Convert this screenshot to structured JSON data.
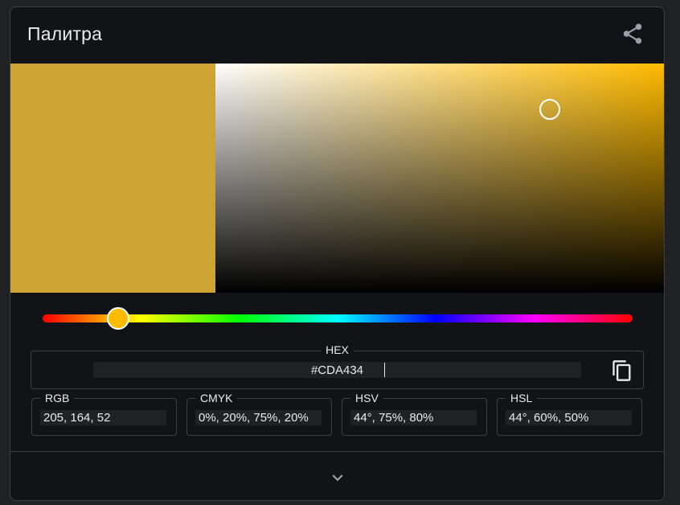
{
  "card": {
    "title": "Палитра",
    "share_icon": "share-icon"
  },
  "color": {
    "swatch_hex": "#CDA434",
    "hue_color": "#ffbb00",
    "hue_degrees": 44,
    "saturation_percent": 75,
    "value_percent": 80
  },
  "fields": {
    "hex": {
      "label": "HEX",
      "value": "#CDA434"
    },
    "rgb": {
      "label": "RGB",
      "value": "205, 164, 52"
    },
    "cmyk": {
      "label": "CMYK",
      "value": "0%, 20%, 75%, 20%"
    },
    "hsv": {
      "label": "HSV",
      "value": "44°, 75%, 80%"
    },
    "hsl": {
      "label": "HSL",
      "value": "44°, 60%, 50%"
    }
  },
  "icons": {
    "copy": "copy-icon",
    "expand": "chevron-down-icon"
  },
  "colors": {
    "background": "#202124",
    "card": "#121317",
    "border": "#3c4043",
    "text": "#e8eaed"
  }
}
